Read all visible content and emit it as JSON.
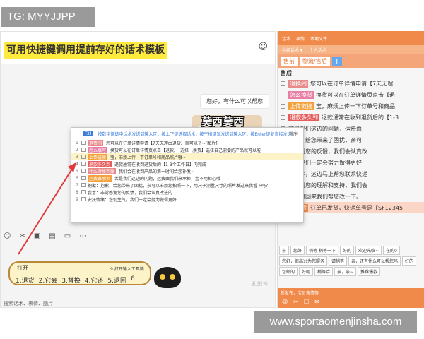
{
  "watermark_top": "TG: MYYJJPP",
  "watermark_bottom": "www.sportaomenjinsha.com",
  "chat": {
    "banner": "可用快捷键调用提前存好的话术模板",
    "message": "您好，有什么可以帮您",
    "sticker_caption": "莫西莫西",
    "send_label": "发送(S)",
    "search_placeholder": "搜索话术、表情、图片"
  },
  "popup": {
    "header_tag": "T.H",
    "header_hint": "按数字键选中话术发送到输入区，按上下键选择话术，按空格键复发送到输入区，按Enter键复直接发送",
    "sort_label": "排序",
    "rows": [
      {
        "n": "1",
        "badge": "退货间",
        "badge_color": "#e88a8a",
        "text": "您可以在订单详情申请【7天无理由退货】就可以了~[图片]"
      },
      {
        "n": "2",
        "badge": "怎么填写",
        "badge_color": "#e87fa4",
        "text": "换货可以在订单详情页点击【退款】，选择【换货】选择自己需要的产品就可以啦"
      },
      {
        "n": "3",
        "badge": "上传链接",
        "badge_color": "#f2a13c",
        "text": "宝，麻烦上传一下订单号和商品照片哦~"
      },
      {
        "n": "4",
        "badge": "退款多久到",
        "badge_color": "#e75d5d",
        "text": "退款通常在收到退货后的【1-3个工作日】内完成"
      },
      {
        "n": "5",
        "badge": "什么时候到账",
        "badge_color": "#e88a8a",
        "text": "我们会在收到产品的第一时间给您补发~"
      },
      {
        "n": "6",
        "badge": "运费谁承担",
        "badge_color": "#f2a13c",
        "text": "若是我们这边的问题，运费由我们来承担，宝不用担心哦"
      },
      {
        "n": "7",
        "badge": "",
        "badge_color": "",
        "text": "抱歉：抱歉，给您带来了困扰，亲可以麻烦您拍照一下，用尺子测量尺寸的照片发过来我看下吗？"
      },
      {
        "n": "8",
        "badge": "",
        "badge_color": "",
        "text": "我意：非常感谢您的反馈，我们会认真改进的"
      },
      {
        "n": "9",
        "badge": "",
        "badge_color": "",
        "text": "安抚情绪：您别生气，我们一定会努力做得更好"
      }
    ]
  },
  "hint": {
    "label": "打开",
    "tip": "9.打开输入工具箱",
    "options": [
      "1.退货",
      "2.它会",
      "3.替换",
      "4.它还",
      "5.退回",
      "6"
    ]
  },
  "side": {
    "top_tabs": [
      "话术",
      "表情",
      "本地文件"
    ],
    "sub_tabs": [
      "小组话术 ▾",
      "个人话术"
    ],
    "tabs": [
      "售前",
      "物流/售后"
    ],
    "add": "+",
    "group": "售后",
    "rows": [
      {
        "badge": "退换间",
        "badge_color": "#e88a8a",
        "text": "您可以在订单详情申请【7天无理"
      },
      {
        "badge": "怎么换货",
        "badge_color": "#e87fa4",
        "text": "换货可以在订单详情页点击【退"
      },
      {
        "badge": "上传链接",
        "badge_color": "#f2a13c",
        "text": "宝，麻烦上传一下订单号和商品"
      },
      {
        "badge": "退款多久到",
        "badge_color": "#e75d5d",
        "text": "退款通常在收到退货后的【1-3"
      },
      {
        "badge": "",
        "badge_color": "",
        "text": "若是我们这边的问题，运费由"
      },
      {
        "badge": "",
        "badge_color": "",
        "text": "抱歉，给您带来了困扰，亲可"
      },
      {
        "badge": "",
        "badge_color": "",
        "text": "常感谢您的反馈，我们会认真改"
      },
      {
        "badge": "",
        "badge_color": "",
        "text": "宝，我们一定会努力做得更好"
      },
      {
        "badge": "",
        "badge_color": "",
        "text": "宝稍等，这边马上帮您联系快递"
      },
      {
        "badge": "",
        "badge_color": "",
        "text": "常感谢您的理解和支持，我们会"
      },
      {
        "badge": "",
        "badge_color": "",
        "text": "可以退回来我们帮您改一下。"
      }
    ],
    "shipped_badge": "已发货",
    "shipped_text": "订单已发货，快递单号是【SF12345",
    "chips": [
      "亲",
      "您好",
      "稍等 稍等一下",
      "好的",
      "欢迎光临~",
      "在的0",
      "您好，很高兴为您服务",
      "请稍等",
      "亲，还有什么可以帮您吗",
      "好的",
      "包邮的",
      "好呢",
      "稍等哈",
      "亲，亲~",
      "推荐爆款"
    ],
    "footer_text": "新发布，宝贝表情等",
    "footer_icons": [
      "☺",
      "✂",
      "☐",
      "✉"
    ]
  }
}
